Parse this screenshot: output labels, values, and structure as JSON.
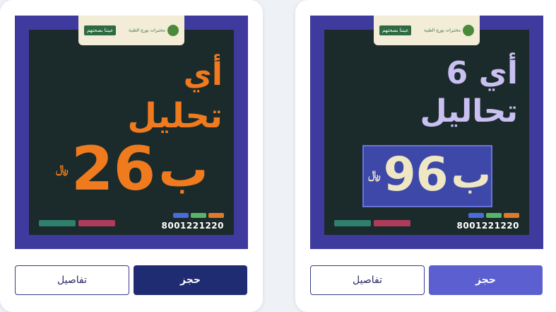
{
  "cards": [
    {
      "logo": {
        "badge": "عيننا بصحتهم",
        "brand": "مختبرات بورج الطبية"
      },
      "headline": [
        "أي",
        "تحليل"
      ],
      "price": "26",
      "price_prefix": "ب",
      "currency": "﷼",
      "phone": "8001221220",
      "buttons": {
        "book": "حجز",
        "details": "تفاصيل"
      },
      "colors": {
        "headline": "#f07a1e",
        "price": "#f07a1e",
        "book_bg": "#1f2c72"
      }
    },
    {
      "logo": {
        "badge": "عيننا بصحتهم",
        "brand": "مختبرات بورج الطبية"
      },
      "headline": [
        "أي 6",
        "تحاليل"
      ],
      "price": "96",
      "price_prefix": "ب",
      "currency": "﷼",
      "phone": "8001221220",
      "buttons": {
        "book": "حجز",
        "details": "تفاصيل"
      },
      "colors": {
        "headline": "#c9bff0",
        "price": "#efe6c4",
        "book_bg": "#5b5fcf"
      }
    }
  ]
}
